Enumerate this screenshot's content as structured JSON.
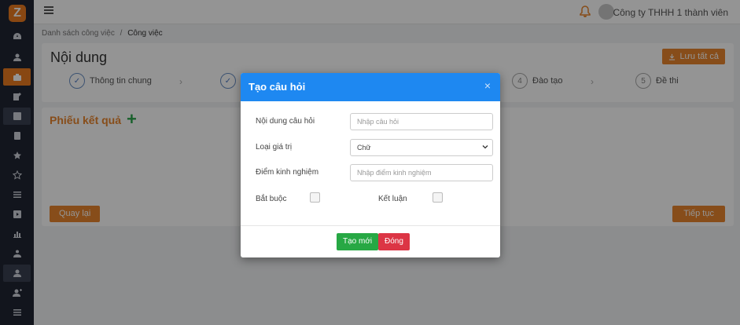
{
  "sidebar": {
    "logo": "Z",
    "items": [
      {
        "icon": "dashboard-icon"
      },
      {
        "icon": "user-icon"
      },
      {
        "icon": "briefcase-icon",
        "active": true
      },
      {
        "icon": "edit-icon"
      },
      {
        "icon": "phone-icon",
        "highlight": true
      },
      {
        "icon": "id-card-icon"
      },
      {
        "icon": "star-half-icon"
      },
      {
        "icon": "star-icon"
      },
      {
        "icon": "list-icon"
      },
      {
        "icon": "play-icon"
      },
      {
        "icon": "chart-icon"
      },
      {
        "icon": "group-icon"
      },
      {
        "icon": "user-circle-icon",
        "highlight": true
      },
      {
        "icon": "user-plus-icon"
      },
      {
        "icon": "list-alt-icon"
      }
    ]
  },
  "topbar": {
    "company": "Công ty THHH 1 thành viên"
  },
  "breadcrumb": {
    "parent": "Danh sách công việc",
    "separator": "/",
    "current": "Công việc"
  },
  "content": {
    "title": "Nội dung",
    "save_all": "Lưu tất cả",
    "steps": [
      {
        "label": "Thông tin chung",
        "marker": "✓"
      },
      {
        "label": "",
        "marker": "✓"
      },
      {
        "label": "Đào tạo",
        "marker": "4"
      },
      {
        "label": "Đề thi",
        "marker": "5"
      }
    ],
    "section_title": "Phiếu kết quả",
    "back": "Quay lại",
    "next": "Tiếp tục"
  },
  "modal": {
    "title": "Tạo câu hỏi",
    "close_symbol": "×",
    "question_label": "Nội dung câu hỏi",
    "question_placeholder": "Nhập câu hỏi",
    "value_type_label": "Loại giá trị",
    "value_type_selected": "Chữ",
    "points_label": "Điểm kinh nghiệm",
    "points_placeholder": "Nhập điểm kinh nghiệm",
    "required_label": "Bắt buộc",
    "conclusion_label": "Kết luận",
    "create_button": "Tạo mới",
    "close_button": "Đóng"
  },
  "colors": {
    "sidebar_bg": "#1f2533",
    "accent_orange": "#e8862d",
    "modal_header": "#1e88f1",
    "create_green": "#27a844",
    "close_red": "#dc3545"
  }
}
